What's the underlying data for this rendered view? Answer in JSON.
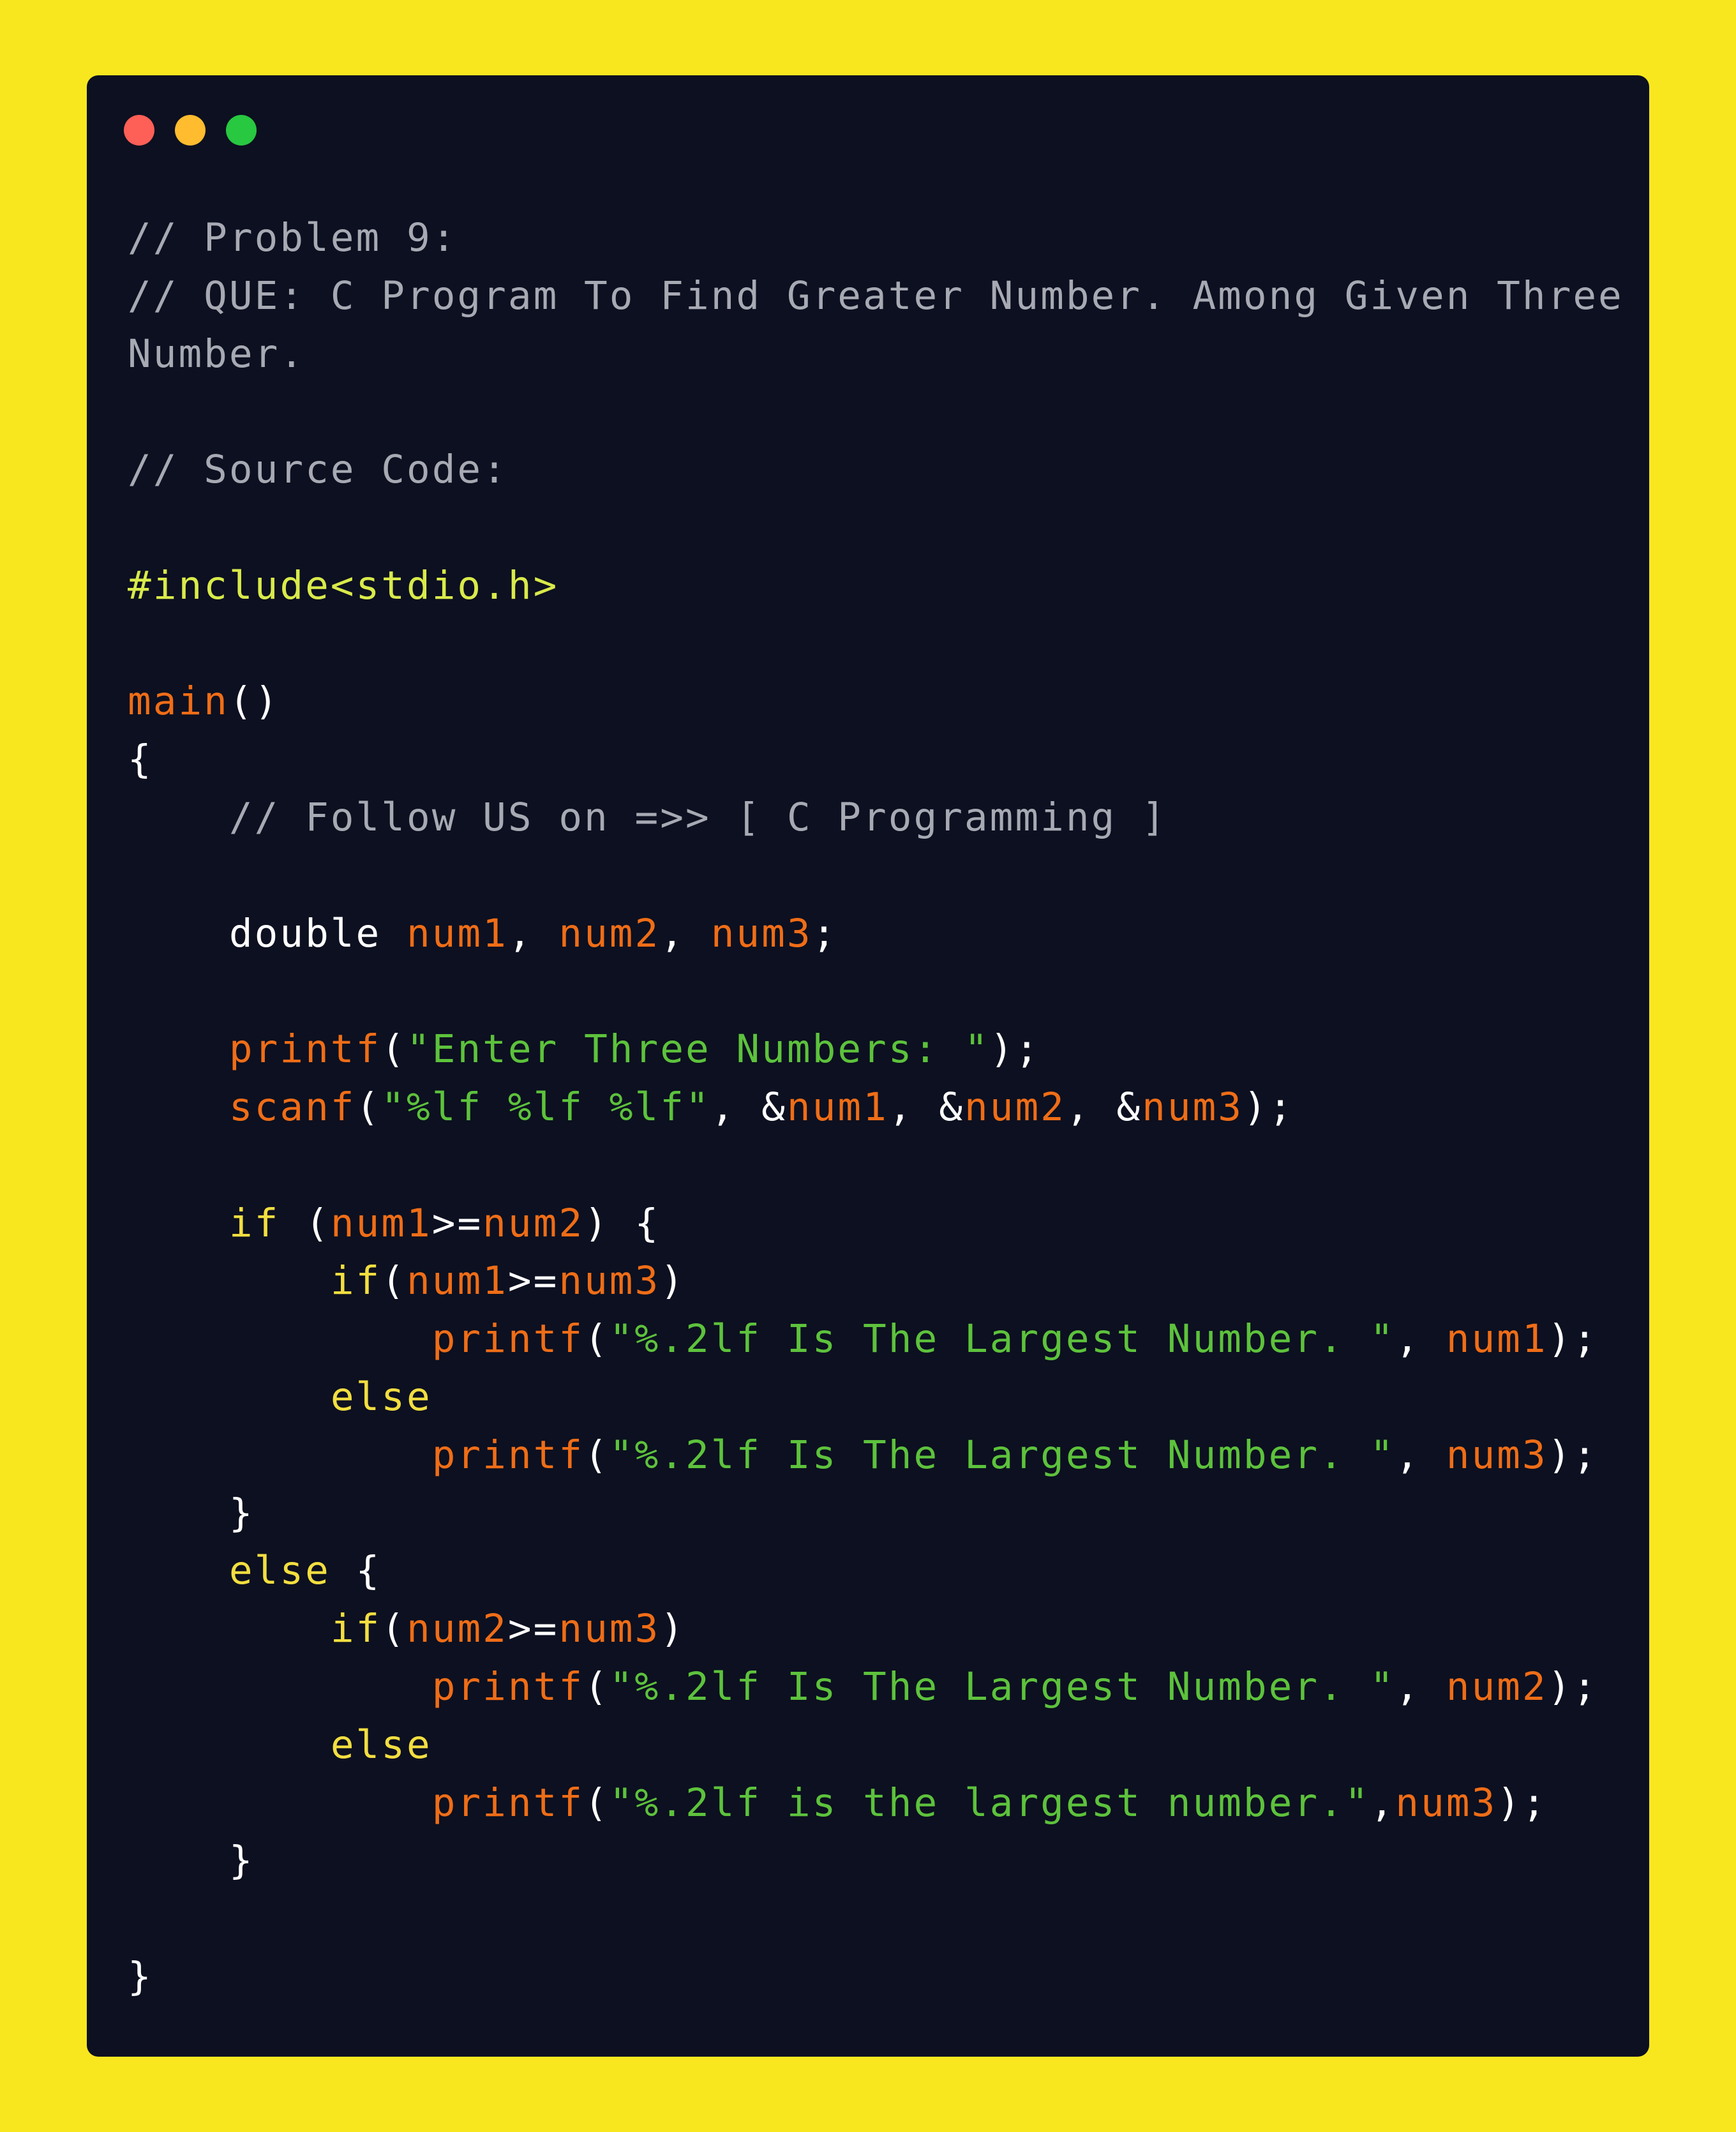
{
  "window": {
    "traffic_lights": [
      {
        "name": "close",
        "color": "#fe5f57"
      },
      {
        "name": "minimize",
        "color": "#febc2e"
      },
      {
        "name": "maximize",
        "color": "#28c840"
      }
    ]
  },
  "colors": {
    "background": "#f8e71f",
    "panel": "#0c1020",
    "comment": "#a7a9b3",
    "preprocessor": "#d9ea4a",
    "function": "#ef6d17",
    "variable": "#ef6d17",
    "keyword": "#f2de40",
    "string": "#5dc23c",
    "type": "#ffffff"
  },
  "code_lines": [
    [
      {
        "t": "comment",
        "v": "// Problem 9:"
      }
    ],
    [
      {
        "t": "comment",
        "v": "// QUE: C Program To Find Greater Number. Among Given Three"
      }
    ],
    [
      {
        "t": "comment",
        "v": "Number."
      }
    ],
    [],
    [
      {
        "t": "comment",
        "v": "// Source Code:"
      }
    ],
    [],
    [
      {
        "t": "pre",
        "v": "#include<stdio.h>"
      }
    ],
    [],
    [
      {
        "t": "func",
        "v": "main"
      },
      {
        "t": "punct",
        "v": "()"
      }
    ],
    [
      {
        "t": "punct",
        "v": "{"
      }
    ],
    [
      {
        "t": "comment",
        "v": "    // Follow US on =>> [ C Programming ]"
      }
    ],
    [],
    [
      {
        "t": "type",
        "v": "    double "
      },
      {
        "t": "var",
        "v": "num1"
      },
      {
        "t": "punct",
        "v": ", "
      },
      {
        "t": "var",
        "v": "num2"
      },
      {
        "t": "punct",
        "v": ", "
      },
      {
        "t": "var",
        "v": "num3"
      },
      {
        "t": "punct",
        "v": ";"
      }
    ],
    [],
    [
      {
        "t": "punct",
        "v": "    "
      },
      {
        "t": "func",
        "v": "printf"
      },
      {
        "t": "punct",
        "v": "("
      },
      {
        "t": "str",
        "v": "\"Enter Three Numbers: \""
      },
      {
        "t": "punct",
        "v": ");"
      }
    ],
    [
      {
        "t": "punct",
        "v": "    "
      },
      {
        "t": "func",
        "v": "scanf"
      },
      {
        "t": "punct",
        "v": "("
      },
      {
        "t": "str",
        "v": "\"%lf %lf %lf\""
      },
      {
        "t": "punct",
        "v": ", &"
      },
      {
        "t": "var",
        "v": "num1"
      },
      {
        "t": "punct",
        "v": ", &"
      },
      {
        "t": "var",
        "v": "num2"
      },
      {
        "t": "punct",
        "v": ", &"
      },
      {
        "t": "var",
        "v": "num3"
      },
      {
        "t": "punct",
        "v": ");"
      }
    ],
    [],
    [
      {
        "t": "punct",
        "v": "    "
      },
      {
        "t": "kw",
        "v": "if"
      },
      {
        "t": "punct",
        "v": " ("
      },
      {
        "t": "var",
        "v": "num1"
      },
      {
        "t": "punct",
        "v": ">="
      },
      {
        "t": "var",
        "v": "num2"
      },
      {
        "t": "punct",
        "v": ") {"
      }
    ],
    [
      {
        "t": "punct",
        "v": "        "
      },
      {
        "t": "kw",
        "v": "if"
      },
      {
        "t": "punct",
        "v": "("
      },
      {
        "t": "var",
        "v": "num1"
      },
      {
        "t": "punct",
        "v": ">="
      },
      {
        "t": "var",
        "v": "num3"
      },
      {
        "t": "punct",
        "v": ")"
      }
    ],
    [
      {
        "t": "punct",
        "v": "            "
      },
      {
        "t": "func",
        "v": "printf"
      },
      {
        "t": "punct",
        "v": "("
      },
      {
        "t": "str",
        "v": "\"%.2lf Is The Largest Number. \""
      },
      {
        "t": "punct",
        "v": ", "
      },
      {
        "t": "var",
        "v": "num1"
      },
      {
        "t": "punct",
        "v": ");"
      }
    ],
    [
      {
        "t": "punct",
        "v": "        "
      },
      {
        "t": "kw",
        "v": "else"
      }
    ],
    [
      {
        "t": "punct",
        "v": "            "
      },
      {
        "t": "func",
        "v": "printf"
      },
      {
        "t": "punct",
        "v": "("
      },
      {
        "t": "str",
        "v": "\"%.2lf Is The Largest Number. \""
      },
      {
        "t": "punct",
        "v": ", "
      },
      {
        "t": "var",
        "v": "num3"
      },
      {
        "t": "punct",
        "v": ");"
      }
    ],
    [
      {
        "t": "punct",
        "v": "    }"
      }
    ],
    [
      {
        "t": "punct",
        "v": "    "
      },
      {
        "t": "kw",
        "v": "else"
      },
      {
        "t": "punct",
        "v": " {"
      }
    ],
    [
      {
        "t": "punct",
        "v": "        "
      },
      {
        "t": "kw",
        "v": "if"
      },
      {
        "t": "punct",
        "v": "("
      },
      {
        "t": "var",
        "v": "num2"
      },
      {
        "t": "punct",
        "v": ">="
      },
      {
        "t": "var",
        "v": "num3"
      },
      {
        "t": "punct",
        "v": ")"
      }
    ],
    [
      {
        "t": "punct",
        "v": "            "
      },
      {
        "t": "func",
        "v": "printf"
      },
      {
        "t": "punct",
        "v": "("
      },
      {
        "t": "str",
        "v": "\"%.2lf Is The Largest Number. \""
      },
      {
        "t": "punct",
        "v": ", "
      },
      {
        "t": "var",
        "v": "num2"
      },
      {
        "t": "punct",
        "v": ");"
      }
    ],
    [
      {
        "t": "punct",
        "v": "        "
      },
      {
        "t": "kw",
        "v": "else"
      }
    ],
    [
      {
        "t": "punct",
        "v": "            "
      },
      {
        "t": "func",
        "v": "printf"
      },
      {
        "t": "punct",
        "v": "("
      },
      {
        "t": "str",
        "v": "\"%.2lf is the largest number.\""
      },
      {
        "t": "punct",
        "v": ","
      },
      {
        "t": "var",
        "v": "num3"
      },
      {
        "t": "punct",
        "v": ");"
      }
    ],
    [
      {
        "t": "punct",
        "v": "    }"
      }
    ],
    [],
    [
      {
        "t": "punct",
        "v": "}"
      }
    ]
  ]
}
